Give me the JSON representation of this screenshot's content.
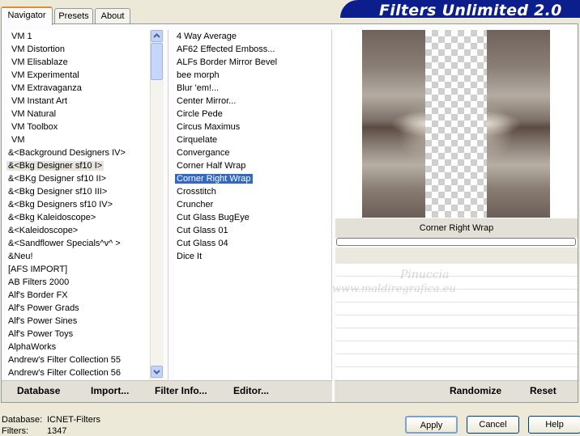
{
  "tabs": [
    "Navigator",
    "Presets",
    "About"
  ],
  "banner": "Filters Unlimited 2.0",
  "categories": [
    "VM 1",
    "VM Distortion",
    "VM Elisablaze",
    "VM Experimental",
    "VM Extravaganza",
    "VM Instant Art",
    "VM Natural",
    "VM Toolbox",
    "VM",
    "&<Background Designers IV>",
    "&<Bkg Designer sf10 I>",
    "&<BKg Designer sf10 II>",
    "&<Bkg Designer sf10 III>",
    "&<Bkg Designers sf10 IV>",
    "&<Bkg Kaleidoscope>",
    "&<Kaleidoscope>",
    "&<Sandflower Specials^v^ >",
    "&Neu!",
    "[AFS IMPORT]",
    "AB Filters 2000",
    "Alf's Border FX",
    "Alf's Power Grads",
    "Alf's Power Sines",
    "Alf's Power Toys",
    "AlphaWorks",
    "Andrew's Filter Collection 55",
    "Andrew's Filter Collection 56"
  ],
  "filters": [
    "4 Way Average",
    "AF62 Effected Emboss...",
    "ALFs Border Mirror Bevel",
    "bee morph",
    "Blur 'em!...",
    "Center Mirror...",
    "Circle Pede",
    "Circus Maximus",
    "Cirquelate",
    "Convergance",
    "Corner Half Wrap",
    "Corner Right Wrap",
    "Crosstitch",
    "Cruncher",
    "Cut Glass  BugEye",
    "Cut Glass 01",
    "Cut Glass 04",
    "Dice It"
  ],
  "preview_label": "Corner Right Wrap",
  "watermark": [
    "Pinuccia",
    "www.maldiregrafica.eu"
  ],
  "bar_left": [
    "Database",
    "Import...",
    "Filter Info...",
    "Editor..."
  ],
  "bar_right": [
    "Randomize",
    "Reset"
  ],
  "status": {
    "database_label": "Database:",
    "database_value": "ICNET-Filters",
    "filters_label": "Filters:",
    "filters_value": "1347"
  },
  "buttons": {
    "apply": "Apply",
    "cancel": "Cancel",
    "help": "Help"
  }
}
